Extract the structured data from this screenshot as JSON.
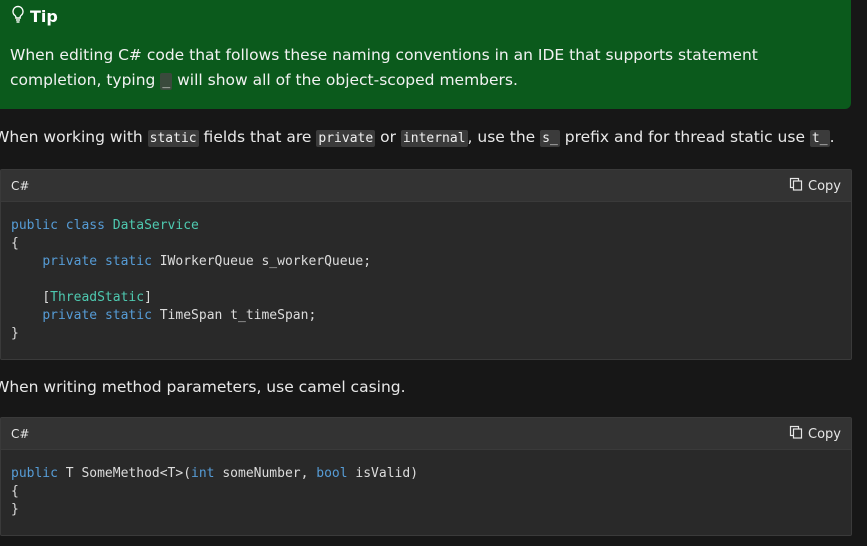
{
  "tip": {
    "title": "Tip",
    "text_before": "When editing C# code that follows these naming conventions in an IDE that supports statement completion, typing",
    "code": "_",
    "text_after": "will show all of the object-scoped members."
  },
  "paragraph1": {
    "t1": "When working with ",
    "c1": "static",
    "t2": " fields that are ",
    "c2": "private",
    "t3": " or ",
    "c3": "internal",
    "t4": ", use the ",
    "c4": "s_",
    "t5": " prefix and for thread static use ",
    "c5": "t_",
    "t6": "."
  },
  "code_block_1": {
    "language": "C#",
    "copy_label": "Copy",
    "tokens": {
      "kw_public": "public",
      "kw_class": "class",
      "class_name": "DataService",
      "open_brace": "{",
      "kw_private1": "private",
      "kw_static1": "static",
      "line1_rest": "IWorkerQueue s_workerQueue;",
      "attr_open": "[",
      "attr_name": "ThreadStatic",
      "attr_close": "]",
      "kw_private2": "private",
      "kw_static2": "static",
      "line2_rest": "TimeSpan t_timeSpan;",
      "close_brace": "}"
    }
  },
  "paragraph2": {
    "text": "When writing method parameters, use camel casing."
  },
  "code_block_2": {
    "language": "C#",
    "copy_label": "Copy",
    "tokens": {
      "kw_public": "public",
      "sig_part1": "T SomeMethod<T>(",
      "kw_int": "int",
      "sig_part2": "someNumber, ",
      "kw_bool": "bool",
      "sig_part3": "isValid)",
      "open_brace": "{",
      "close_brace": "}"
    }
  }
}
